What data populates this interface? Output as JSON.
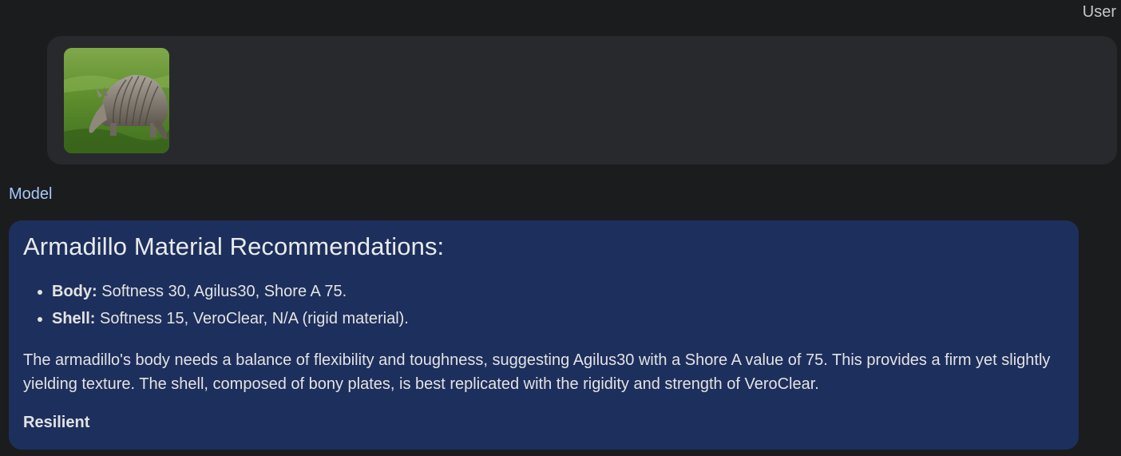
{
  "user": {
    "label": "User",
    "attachment_icon": "armadillo-photo"
  },
  "model": {
    "label": "Model",
    "title": "Armadillo Material Recommendations:",
    "items": [
      {
        "name": "Body:",
        "detail": "Softness 30, Agilus30, Shore A 75."
      },
      {
        "name": "Shell:",
        "detail": "Softness 15, VeroClear, N/A (rigid material)."
      }
    ],
    "paragraph": "The armadillo's body needs a balance of flexibility and toughness, suggesting Agilus30 with a Shore A value of 75. This provides a firm yet slightly yielding texture. The shell, composed of bony plates, is best replicated with the rigidity and strength of VeroClear.",
    "footer": "Resilient"
  },
  "colors": {
    "background": "#1b1c1e",
    "user_bubble": "#28292c",
    "model_card": "#1d2f5c",
    "model_label": "#a8c7fa"
  }
}
